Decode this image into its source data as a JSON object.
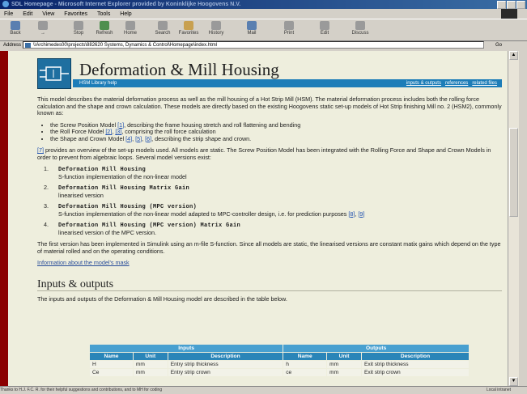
{
  "window": {
    "title": "SDL Homepage - Microsoft Internet Explorer provided by Koninklijke Hoogovens N.V."
  },
  "menu": [
    "File",
    "Edit",
    "View",
    "Favorites",
    "Tools",
    "Help"
  ],
  "toolbar": {
    "back": "Back",
    "forward": "→",
    "stop": "Stop",
    "refresh": "Refresh",
    "home": "Home",
    "search": "Search",
    "favorites": "Favorites",
    "history": "History",
    "mail": "Mail",
    "print": "Print",
    "edit": "Edit",
    "discuss": "Discuss"
  },
  "address": {
    "label": "Address",
    "url": "\\\\Archimedes00\\projects\\882620 Systems, Dynamics & Control\\Homepage\\index.html",
    "go": "Go"
  },
  "page": {
    "title": "Deformation & Mill Housing",
    "band_left": "HSM Library help",
    "band_links": [
      "inputs & outputs",
      "references",
      "related files"
    ],
    "intro": "This model describes the material deformation process as well as the mill housing of a Hot Strip Mill (HSM). The material deformation process includes both the rolling force calculation and the shape and crown calculation. These models are directly based on the existing Hoogovens static set-up models of Hot Strip finishing Mill no. 2 (HSM2), commonly known as:",
    "bullets": [
      {
        "pre": "the Screw Position Model ",
        "refs": [
          "[1]"
        ],
        "post": ", describing the frame housing stretch and roll flattening and bending"
      },
      {
        "pre": "the Roll Force Model ",
        "refs": [
          "[2]",
          "[3]"
        ],
        "post": ", comprising the roll force calculation"
      },
      {
        "pre": "the Shape and Crown Model ",
        "refs": [
          "[4]",
          "[5]",
          "[6]"
        ],
        "post": ", describing the strip shape and crown."
      }
    ],
    "overview_ref": "[7]",
    "overview": " provides an overview of the set-up models used. All models are static. The Screw Position Model has been integrated with the Rolling Force and Shape and Crown Models in order to prevent from algebraic loops. Several model versions exist:",
    "models": [
      {
        "num": "1.",
        "name": "Deformation Mill Housing",
        "desc": "S-function implementation of the non-linear model",
        "refs": []
      },
      {
        "num": "2.",
        "name": "Deformation Mill Housing Matrix Gain",
        "desc": "linearised version",
        "refs": []
      },
      {
        "num": "3.",
        "name": "Deformation Mill Housing (MPC version)",
        "desc": "S-function implementation of the non-linear model adapted to MPC-controller design, i.e. for prediction purposes ",
        "refs": [
          "[8]",
          "[9]"
        ]
      },
      {
        "num": "4.",
        "name": "Deformation Mill Housing (MPC version) Matrix Gain",
        "desc": "linearised version of the MPC version.",
        "refs": []
      }
    ],
    "first_version": "The first version has been implemented in Simulink using an m-file S-function. Since all models are static, the linearised versions are constant matix gains which depend on the type of material rolled and on the operating conditions.",
    "mask_link": "Information about the model's mask",
    "io_heading": "Inputs & outputs",
    "io_intro": "The inputs and outputs of the Deformation & Mill Housing model are described in the table below.",
    "table": {
      "group_inputs": "Inputs",
      "group_outputs": "Outputs",
      "columns": [
        "Name",
        "Unit",
        "Description",
        "Name",
        "Unit",
        "Description"
      ],
      "rows": [
        [
          "H",
          "mm",
          "Entry strip thickness",
          "h",
          "mm",
          "Exit strip thickness"
        ],
        [
          "Ce",
          "mm",
          "Entry strip crown",
          "ce",
          "mm",
          "Exit strip crown"
        ]
      ]
    }
  },
  "status": {
    "text": "Thanks to H.J. F.C. R. for their helpful suggestions and contributions, and to MH for coding",
    "zone": "Local intranet"
  }
}
